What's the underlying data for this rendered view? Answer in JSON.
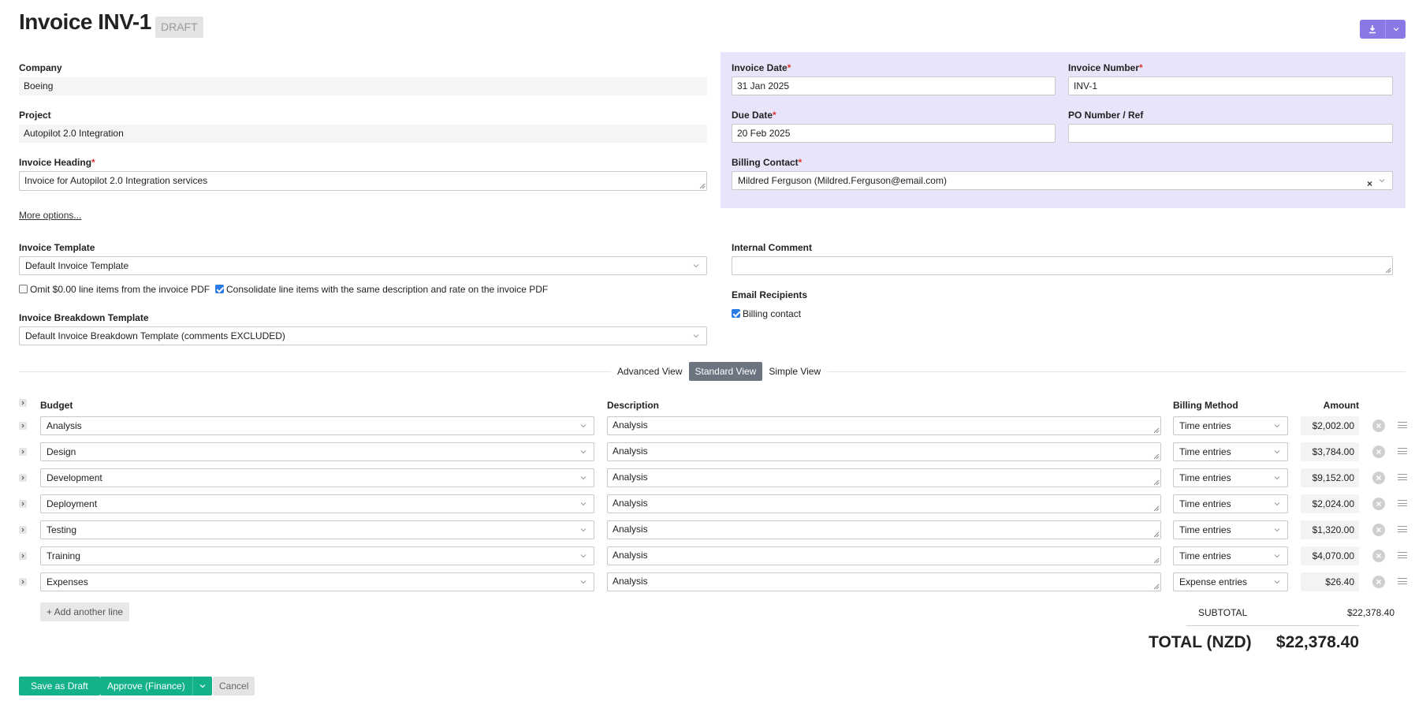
{
  "header": {
    "title": "Invoice INV-1",
    "status_badge": "DRAFT"
  },
  "left": {
    "company_label": "Company",
    "company_value": "Boeing",
    "project_label": "Project",
    "project_value": "Autopilot 2.0 Integration",
    "heading_label": "Invoice Heading",
    "heading_value": "Invoice for Autopilot 2.0 Integration services",
    "more_options": "More options...",
    "template_label": "Invoice Template",
    "template_value": "Default Invoice Template",
    "omit_zero_label": "Omit $0.00 line items from the invoice PDF",
    "consolidate_label": "Consolidate line items with the same description and rate on the invoice PDF",
    "breakdown_label": "Invoice Breakdown Template",
    "breakdown_value": "Default Invoice Breakdown Template (comments EXCLUDED)"
  },
  "right": {
    "invoice_date_label": "Invoice Date",
    "invoice_date_value": "31 Jan 2025",
    "invoice_number_label": "Invoice Number",
    "invoice_number_value": "INV-1",
    "due_date_label": "Due Date",
    "due_date_value": "20 Feb 2025",
    "po_label": "PO Number / Ref",
    "po_value": "",
    "billing_contact_label": "Billing Contact",
    "billing_contact_value": "Mildred Ferguson (Mildred.Ferguson@email.com)",
    "internal_comment_label": "Internal Comment",
    "internal_comment_value": "",
    "email_recipients_label": "Email Recipients",
    "billing_contact_check": "Billing contact"
  },
  "required_mark": "*",
  "views": {
    "advanced": "Advanced View",
    "standard": "Standard View",
    "simple": "Simple View"
  },
  "table": {
    "headers": {
      "budget": "Budget",
      "description": "Description",
      "billing_method": "Billing Method",
      "amount": "Amount"
    },
    "rows": [
      {
        "budget": "Analysis",
        "description": "Analysis",
        "method": "Time entries",
        "amount": "$2,002.00"
      },
      {
        "budget": "Design",
        "description": "Analysis",
        "method": "Time entries",
        "amount": "$3,784.00"
      },
      {
        "budget": "Development",
        "description": "Analysis",
        "method": "Time entries",
        "amount": "$9,152.00"
      },
      {
        "budget": "Deployment",
        "description": "Analysis",
        "method": "Time entries",
        "amount": "$2,024.00"
      },
      {
        "budget": "Testing",
        "description": "Analysis",
        "method": "Time entries",
        "amount": "$1,320.00"
      },
      {
        "budget": "Training",
        "description": "Analysis",
        "method": "Time entries",
        "amount": "$4,070.00"
      },
      {
        "budget": "Expenses",
        "description": "Analysis",
        "method": "Expense entries",
        "amount": "$26.40"
      }
    ],
    "add_line": "+ Add another line"
  },
  "totals": {
    "subtotal_label": "SUBTOTAL",
    "subtotal_value": "$22,378.40",
    "total_label": "TOTAL (NZD)",
    "total_value": "$22,378.40"
  },
  "actions": {
    "save_draft": "Save as Draft",
    "approve": "Approve (Finance)",
    "cancel": "Cancel"
  },
  "colors": {
    "accent_purple": "#8b78e6",
    "panel_purple": "#e8e5fa",
    "green": "#14b28a",
    "active_view": "#6c7480"
  }
}
